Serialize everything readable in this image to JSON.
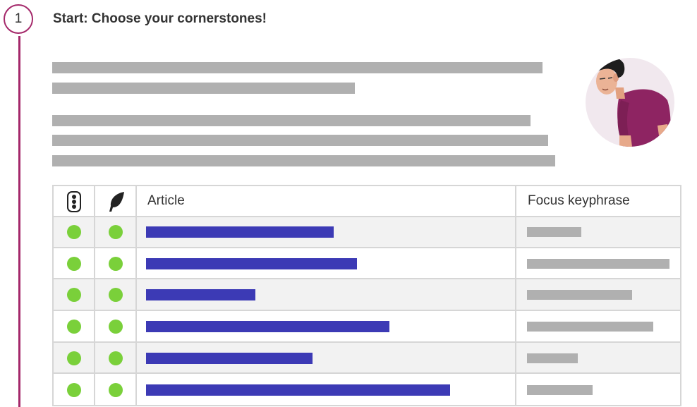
{
  "step": {
    "number": "1",
    "title": "Start: Choose your cornerstones!"
  },
  "colors": {
    "accent": "#a4286a",
    "placeholder": "#b0b0b0",
    "link": "#3c3ab5",
    "status_good": "#7ad03a",
    "row_shade": "#f2f2f2"
  },
  "table": {
    "columns": [
      {
        "icon": "traffic-light-icon",
        "label": ""
      },
      {
        "icon": "feather-icon",
        "label": ""
      },
      {
        "label": "Article"
      },
      {
        "label": "Focus keyphrase"
      }
    ],
    "rows": [
      {
        "seo_status": "good",
        "readability_status": "good"
      },
      {
        "seo_status": "good",
        "readability_status": "good"
      },
      {
        "seo_status": "good",
        "readability_status": "good"
      },
      {
        "seo_status": "good",
        "readability_status": "good"
      },
      {
        "seo_status": "good",
        "readability_status": "good"
      },
      {
        "seo_status": "good",
        "readability_status": "good"
      }
    ]
  },
  "illustration": "tired-person-avatar"
}
